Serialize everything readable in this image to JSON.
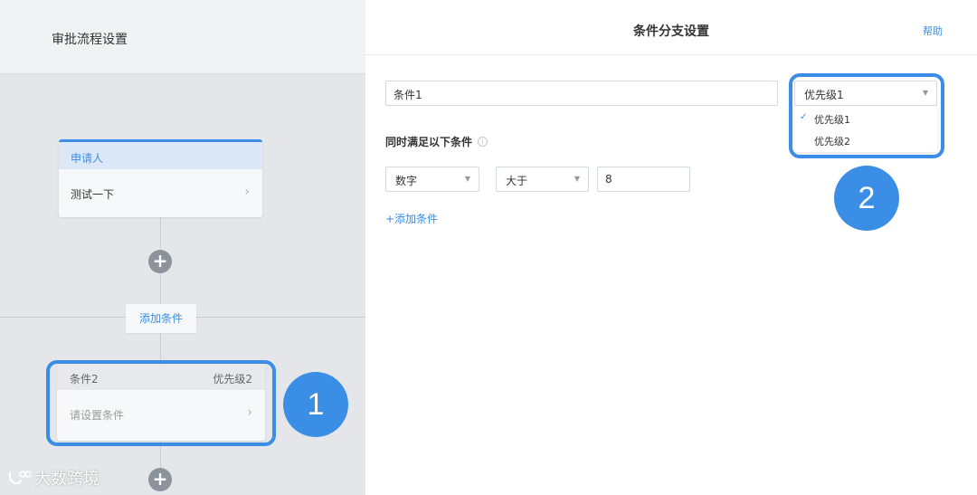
{
  "left_panel": {
    "title": "审批流程设置",
    "applicant_card": {
      "header": "申请人",
      "value": "测试一下"
    },
    "add_condition_button": "添加条件",
    "condition_card": {
      "name": "条件2",
      "priority": "优先级2",
      "placeholder": "请设置条件"
    }
  },
  "right_panel": {
    "title": "条件分支设置",
    "help": "帮助",
    "condition_name": "条件1",
    "priority_select": {
      "selected": "优先级1",
      "options": [
        "优先级1",
        "优先级2"
      ]
    },
    "rules_label": "同时满足以下条件",
    "rule": {
      "field_type": "数字",
      "operator": "大于",
      "value": "8"
    },
    "add_condition_link": "+添加条件"
  },
  "annotations": {
    "badge_1": "1",
    "badge_2": "2",
    "highlight_color": "#3a8ee6"
  },
  "watermark": "大数跨境",
  "icons": {
    "chevron": "chevron-right-icon",
    "plus": "plus-circle-icon",
    "check": "check-icon",
    "caret": "caret-down-icon",
    "info": "info-icon",
    "logo": "watermark-logo-icon"
  },
  "accent_color": "#3a8ee6"
}
